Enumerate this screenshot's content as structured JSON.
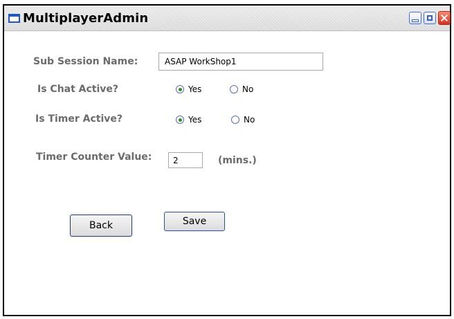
{
  "window": {
    "title": "MultiplayerAdmin",
    "controls": {
      "minimize_icon": "minimize-icon",
      "maximize_icon": "maximize-icon",
      "close_icon": "close-icon"
    }
  },
  "form": {
    "sub_session": {
      "label": "Sub Session Name:",
      "value": "ASAP WorkShop1"
    },
    "chat_active": {
      "label": "Is Chat Active?",
      "options": [
        {
          "label": "Yes",
          "checked": true
        },
        {
          "label": "No",
          "checked": false
        }
      ]
    },
    "timer_active": {
      "label": "Is Timer Active?",
      "options": [
        {
          "label": "Yes",
          "checked": true
        },
        {
          "label": "No",
          "checked": false
        }
      ]
    },
    "timer_counter": {
      "label": "Timer Counter Value:",
      "value": "2",
      "units": "(mins.)"
    }
  },
  "buttons": {
    "back_label": "Back",
    "save_label": "Save"
  },
  "colors": {
    "label": "#6b6b6b",
    "window_border": "#000000",
    "accent": "#2d8f2d"
  }
}
